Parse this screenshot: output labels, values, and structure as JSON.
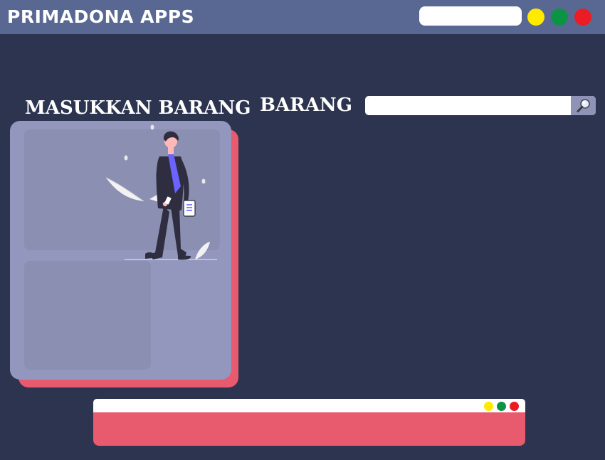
{
  "header": {
    "title": "PRIMADONA APPS",
    "search_value": "",
    "window_controls": [
      {
        "name": "minimize-dot",
        "color": "#ffea00"
      },
      {
        "name": "maximize-dot",
        "color": "#0b9444"
      },
      {
        "name": "close-dot",
        "color": "#ec1c24"
      }
    ]
  },
  "input_section": {
    "title": "MASUKKAN BARANG"
  },
  "items_section": {
    "title": "BARANG",
    "search_value": "",
    "search_icon": "magnifier-icon"
  },
  "bottom_window": {
    "controls": [
      "#ffea00",
      "#0b9444",
      "#ec1c24"
    ]
  },
  "colors": {
    "background": "#2d3450",
    "header": "#586892",
    "accent": "#e85a6e",
    "card": "#9397bd",
    "panel": "#8b8fb1",
    "illustration_accent": "#6c63ff"
  }
}
